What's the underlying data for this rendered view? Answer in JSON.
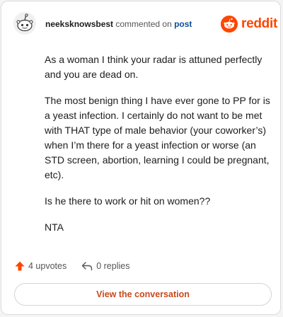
{
  "header": {
    "username": "neeksknowsbest",
    "action_text": " commented on ",
    "link_text": "post"
  },
  "logo": {
    "text": "reddit",
    "icon": "reddit-snoo-icon",
    "color": "#ff4500"
  },
  "avatar": {
    "icon": "reddit-default-avatar-icon"
  },
  "comment": {
    "paragraphs": [
      "As a woman I think your radar is attuned perfectly and you are dead on.",
      "The most benign thing I have ever gone to PP for is a yeast infection. I certainly do not want to be met with THAT type of male behavior (your coworker’s) when I’m there for a yeast infection or worse (an STD screen, abortion, learning I could be pregnant, etc).",
      "Is he there to work or hit on women??",
      "NTA"
    ]
  },
  "actions": {
    "upvotes": "4 upvotes",
    "upvote_icon": "upvote-arrow-icon",
    "replies": "0 replies",
    "reply_icon": "reply-arrow-icon"
  },
  "button": {
    "label": "View the conversation"
  },
  "colors": {
    "accent": "#ff4500",
    "button_text": "#c8491b",
    "link": "#0a4f9c"
  }
}
